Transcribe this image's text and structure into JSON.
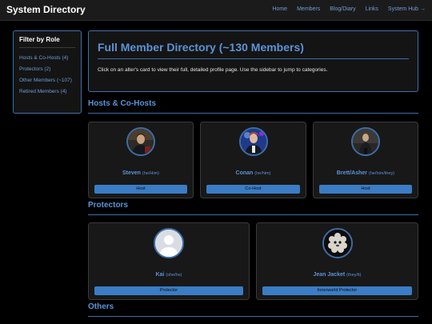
{
  "header": {
    "brand": "System Directory",
    "nav": [
      "Home",
      "Members",
      "Blog/Diary",
      "Links",
      "System Hub →"
    ]
  },
  "sidebar": {
    "title": "Filter by Role",
    "items": [
      {
        "label": "Hosts & Co-Hosts (4)"
      },
      {
        "label": "Protectors (2)"
      },
      {
        "label": "Other Members (~107)"
      },
      {
        "label": "Retired Members (4)"
      }
    ]
  },
  "intro": {
    "title": "Full Member Directory (~130 Members)",
    "text": "Click on an alter's card to view their full, detailed profile page. Use the sidebar to jump to categories."
  },
  "sections": {
    "hosts": {
      "heading": "Hosts & Co-Hosts",
      "cards": [
        {
          "name": "Steven",
          "pronouns": "(he/Him)",
          "role": "Host"
        },
        {
          "name": "Conan",
          "pronouns": "(he/him)",
          "role": "Co-Host"
        },
        {
          "name": "Brett/Asher",
          "pronouns": "(he/him/they)",
          "role": "Host"
        }
      ]
    },
    "protectors": {
      "heading": "Protectors",
      "cards": [
        {
          "name": "Kai",
          "pronouns": "(she/he)",
          "role": "Protector"
        },
        {
          "name": "Jean Jacket",
          "pronouns": "(they/it)",
          "role": "Innerworld Protector"
        }
      ]
    },
    "others": {
      "heading": "Others"
    }
  },
  "colors": {
    "accent": "#5b93d6",
    "button": "#3b7cc4",
    "background": "#000000",
    "panel": "#141414"
  },
  "icons": {
    "placeholder_avatar": "user-silhouette-icon"
  }
}
